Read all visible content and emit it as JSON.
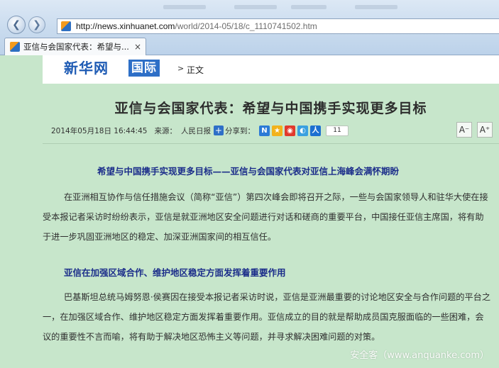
{
  "browser": {
    "address_host": "http://news.xinhuanet.com",
    "address_path": "/world/2014-05/18/c_1110741502.htm",
    "tab_title": "亚信与会国家代表：希望与...",
    "tab_close": "×"
  },
  "header": {
    "brand": "新华网",
    "channel": "国际",
    "breadcrumb_sep": ">",
    "breadcrumb_current": "正文"
  },
  "article": {
    "title": "亚信与会国家代表：希望与中国携手实现更多目标",
    "date": "2014年05月18日 16:44:45",
    "source_label": "来源：",
    "source": "人民日报",
    "share_label": "分享到：",
    "share_count": "11",
    "font_small": "A⁻",
    "font_large": "A⁺",
    "subheading1": "希望与中国携手实现更多目标——亚信与会国家代表对亚信上海峰会满怀期盼",
    "paragraph1": "在亚洲相互协作与信任措施会议（简称“亚信”）第四次峰会即将召开之际，一些与会国家领导人和驻华大使在接受本报记者采访时纷纷表示，亚信是就亚洲地区安全问题进行对话和磋商的重要平台，中国接任亚信主席国，将有助于进一步巩固亚洲地区的稳定、加深亚洲国家间的相互信任。",
    "subheading2": "亚信在加强区域合作、维护地区稳定方面发挥着重要作用",
    "paragraph2": "巴基斯坦总统马姆努恩·侯赛因在接受本报记者采访时说，亚信是亚洲最重要的讨论地区安全与合作问题的平台之一，在加强区域合作、维护地区稳定方面发挥着重要作用。亚信成立的目的就是帮助成员国克服面临的一些困难，会议的重要性不言而喻，将有助于解决地区恐怖主义等问题，并寻求解决困难问题的对策。"
  },
  "watermark": "安全客（www.anquanke.com）",
  "colors": {
    "page_bg": "#c7e6cb",
    "brand_blue": "#1e5bb4",
    "subheading": "#1b2d8a"
  }
}
